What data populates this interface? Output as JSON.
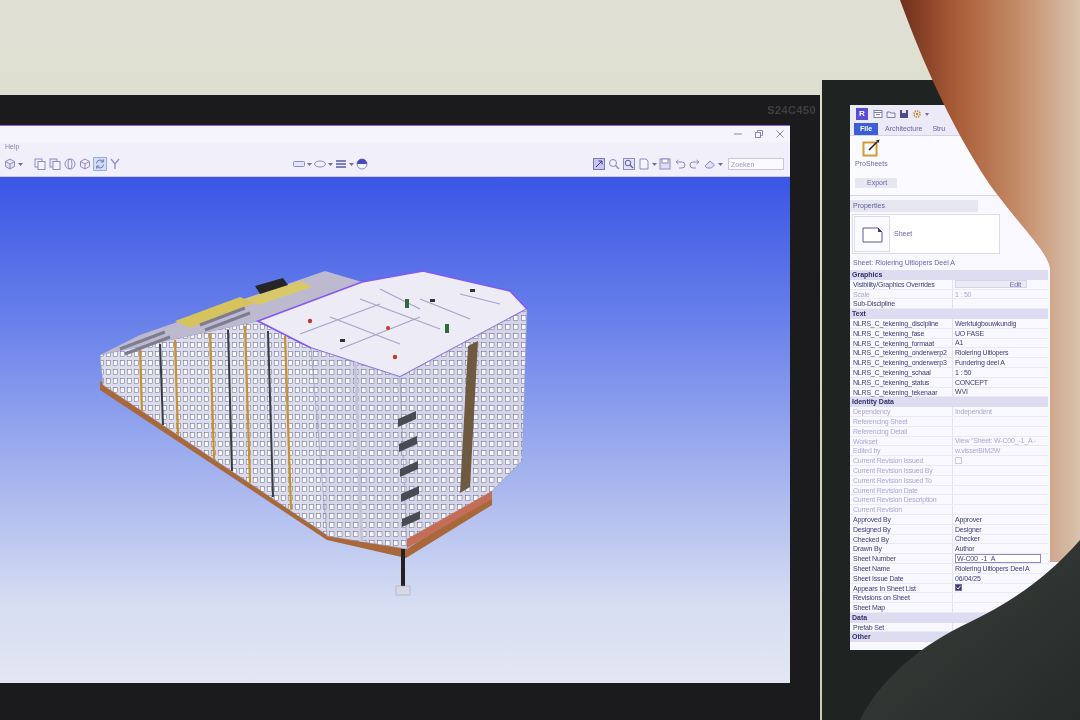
{
  "left_monitor": {
    "model": "S24C450",
    "menu": [
      {
        "label": "Help"
      }
    ],
    "toolbar": {
      "left": [
        {
          "selected": false,
          "dropdown": true
        },
        {
          "selected": false,
          "dropdown": false
        },
        {
          "selected": false,
          "dropdown": false
        },
        {
          "selected": false,
          "dropdown": false
        },
        {
          "selected": false,
          "dropdown": false
        },
        {
          "selected": true,
          "dropdown": false
        },
        {
          "selected": false,
          "dropdown": false
        }
      ],
      "middle": [
        {
          "selected": false,
          "dropdown": true
        },
        {
          "selected": false,
          "dropdown": true
        },
        {
          "selected": false,
          "dropdown": true
        },
        {
          "selected": false,
          "dropdown": false
        }
      ],
      "right": [
        {
          "selected": false,
          "dropdown": false
        },
        {
          "selected": false,
          "dropdown": false
        },
        {
          "selected": false,
          "dropdown": false
        },
        {
          "selected": false,
          "dropdown": true
        },
        {
          "selected": false,
          "dropdown": false
        },
        {
          "selected": false,
          "dropdown": false
        },
        {
          "selected": false,
          "dropdown": false
        },
        {
          "selected": false,
          "dropdown": true
        }
      ]
    },
    "search": {
      "placeholder": "Zoeken"
    }
  },
  "right_monitor": {
    "logo": "R",
    "quick_access": [
      {
        "dropdown": false
      },
      {
        "dropdown": false
      },
      {
        "dropdown": false
      },
      {
        "dropdown": true
      }
    ],
    "ribbon_tabs": [
      {
        "label": "File",
        "kind": "menu",
        "selected": false
      },
      {
        "label": "Architecture",
        "kind": "tab",
        "selected": false
      },
      {
        "label": "Stru",
        "kind": "tab",
        "selected": false
      }
    ],
    "ribbon_tool": {
      "label": "ProSheets"
    },
    "ribbon_panel": {
      "label": "Export"
    },
    "properties": {
      "title": "Properties",
      "type": "Sheet",
      "instance": "Sheet: Riolering Uitlopers Deel A",
      "groups": [
        {
          "title": "Graphics",
          "rows": [
            {
              "name": "Visibility/Graphics Overrides",
              "kind": "button",
              "value": "Edit",
              "disabled": false
            },
            {
              "name": "Scale",
              "kind": "text",
              "value": "1 : 50",
              "disabled": true
            },
            {
              "name": "Sub-Discipline",
              "kind": "text",
              "disabled": false
            }
          ]
        },
        {
          "title": "Text",
          "rows": [
            {
              "name": "NLRS_C_tekening_discipline",
              "kind": "text",
              "value": "Werktuigbouwkundig",
              "disabled": false
            },
            {
              "name": "NLRS_C_tekening_fase",
              "kind": "text",
              "value": "UO FASE",
              "disabled": false
            },
            {
              "name": "NLRS_C_tekening_formaat",
              "kind": "text",
              "value": "A1",
              "disabled": false
            },
            {
              "name": "NLRS_C_tekening_onderwerp2",
              "kind": "text",
              "value": "Riolering Uitlopers",
              "disabled": false
            },
            {
              "name": "NLRS_C_tekening_onderwerp3",
              "kind": "text",
              "value": "Fundering deel A",
              "disabled": false
            },
            {
              "name": "NLRS_C_tekening_schaal",
              "kind": "text",
              "value": "1 : 50",
              "disabled": false
            },
            {
              "name": "NLRS_C_tekening_status",
              "kind": "text",
              "value": "CONCEPT",
              "disabled": false
            },
            {
              "name": "NLRS_C_tekening_tekenaar",
              "kind": "text",
              "value": "WVI",
              "disabled": false
            }
          ]
        },
        {
          "title": "Identity Data",
          "rows": [
            {
              "name": "Dependency",
              "kind": "text",
              "value": "Independent",
              "disabled": true
            },
            {
              "name": "Referencing Sheet",
              "kind": "text",
              "disabled": true
            },
            {
              "name": "Referencing Detail",
              "kind": "text",
              "disabled": true
            },
            {
              "name": "Workset",
              "kind": "text",
              "value": "View \"Sheet: W-C00_-1_A -",
              "disabled": true
            },
            {
              "name": "Edited by",
              "kind": "text",
              "value": "w.visserBIM2W",
              "disabled": true
            },
            {
              "name": "Current Revision Issued",
              "kind": "checkbox",
              "checked": false,
              "disabled": true
            },
            {
              "name": "Current Revision Issued By",
              "kind": "text",
              "disabled": true
            },
            {
              "name": "Current Revision Issued To",
              "kind": "text",
              "disabled": true
            },
            {
              "name": "Current Revision Date",
              "kind": "text",
              "disabled": true
            },
            {
              "name": "Current Revision Description",
              "kind": "text",
              "disabled": true
            },
            {
              "name": "Current Revision",
              "kind": "text",
              "disabled": true
            },
            {
              "name": "Approved By",
              "kind": "text",
              "value": "Approver",
              "disabled": false
            },
            {
              "name": "Designed By",
              "kind": "text",
              "value": "Designer",
              "disabled": false
            },
            {
              "name": "Checked By",
              "kind": "text",
              "value": "Checker",
              "disabled": false
            },
            {
              "name": "Drawn By",
              "kind": "text",
              "value": "Author",
              "disabled": false
            },
            {
              "name": "Sheet Number",
              "kind": "field",
              "value": "W-C00_-1_A",
              "disabled": false
            },
            {
              "name": "Sheet Name",
              "kind": "text",
              "value": "Riolering Uitlopers Deel A",
              "disabled": false
            },
            {
              "name": "Sheet Issue Date",
              "kind": "text",
              "value": "06/04/25",
              "disabled": false
            },
            {
              "name": "Appears In Sheet List",
              "kind": "checkbox",
              "checked": true,
              "disabled": false
            },
            {
              "name": "Revisions on Sheet",
              "kind": "text",
              "disabled": false
            },
            {
              "name": "Sheet Map",
              "kind": "text",
              "disabled": false
            }
          ]
        },
        {
          "title": "Data",
          "rows": [
            {
              "name": "Prefab Set",
              "kind": "text",
              "disabled": false
            }
          ]
        },
        {
          "title": "Other"
        }
      ]
    }
  }
}
